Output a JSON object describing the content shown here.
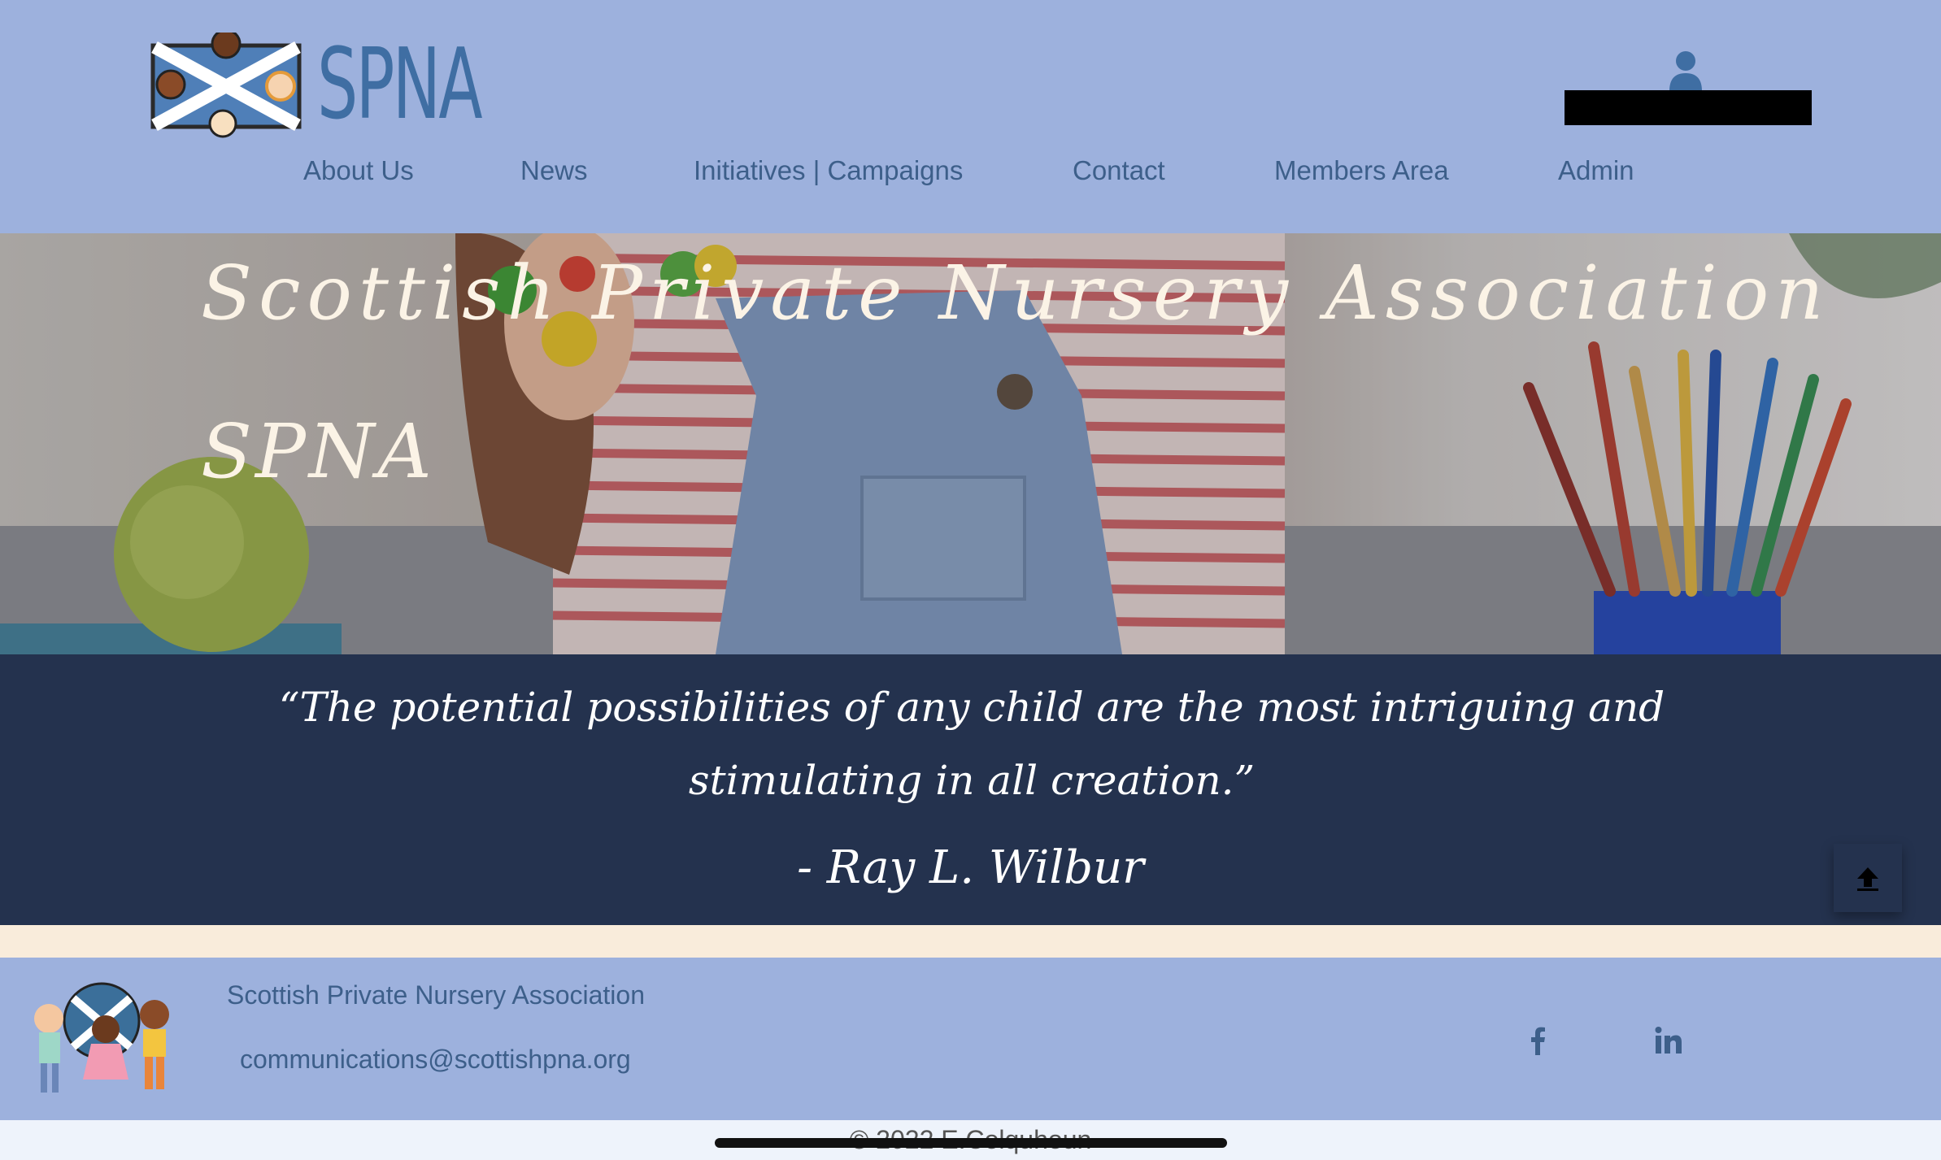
{
  "header": {
    "logo_text": "SPNA",
    "nav": [
      "About Us",
      "News",
      "Initiatives | Campaigns",
      "Contact",
      "Members Area",
      "Admin"
    ]
  },
  "hero": {
    "title": "Scottish Private Nursery Association",
    "subtitle": "SPNA"
  },
  "quote": {
    "text": "“The potential possibilities of any child are the most intriguing and stimulating in all creation.”",
    "author": "- Ray L. Wilbur"
  },
  "footer": {
    "org_name": "Scottish Private Nursery Association",
    "email": "communications@scottishpna.org",
    "copyright": "© 2022 E.Colquhoun",
    "social": [
      "facebook-icon",
      "linkedin-icon"
    ]
  },
  "colors": {
    "header_bg": "#9db1dd",
    "nav_text": "#3d5f8a",
    "quote_bg": "#24324e",
    "cream": "#f9ecdb",
    "hero_text": "#fbf3e6"
  }
}
